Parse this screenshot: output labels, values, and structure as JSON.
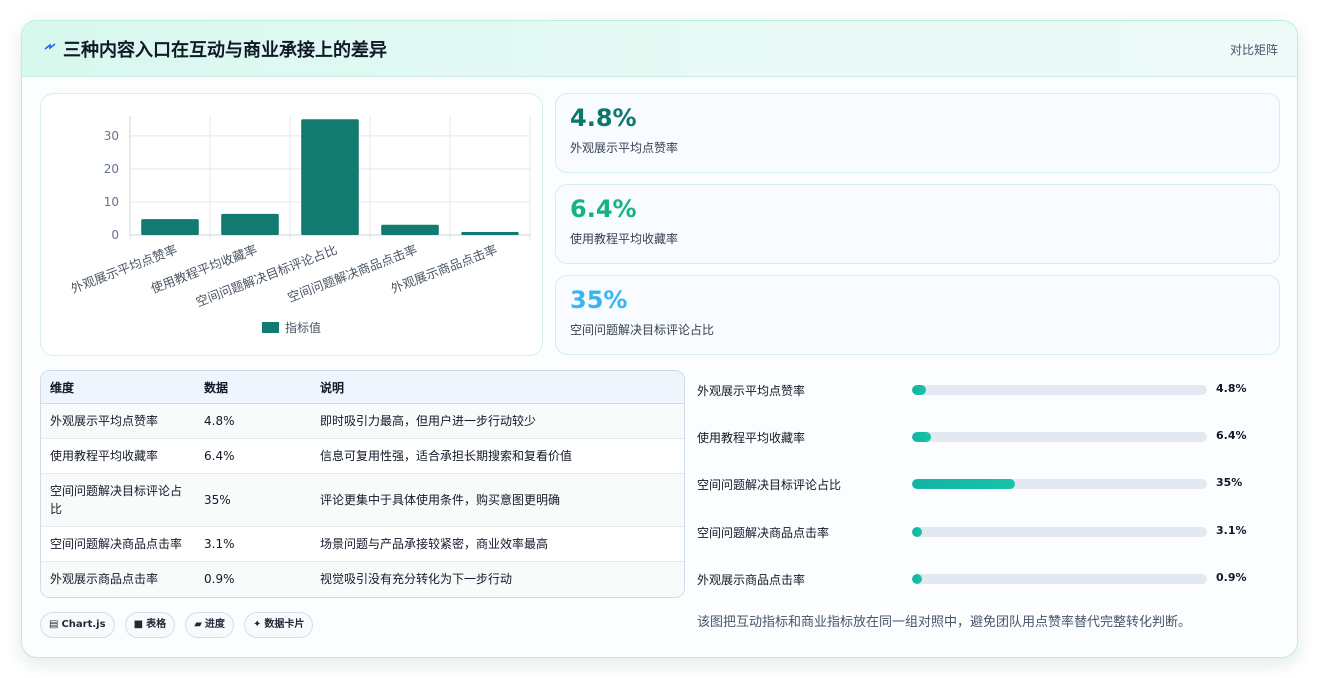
{
  "header": {
    "title": "三种内容入口在互动与商业承接上的差异",
    "tag": "对比矩阵"
  },
  "colors": {
    "bar": "#127a6e",
    "kpi_1": "#0f766e",
    "kpi_2": "#16b37f",
    "kpi_3": "#3bb5f0",
    "progress": "#12b3a4"
  },
  "chart_data": {
    "type": "bar",
    "categories": [
      "外观展示平均点赞率",
      "使用教程平均收藏率",
      "空间问题解决目标评论占比",
      "空间问题解决商品点击率",
      "外观展示商品点击率"
    ],
    "series": [
      {
        "name": "指标值",
        "values": [
          4.8,
          6.4,
          35,
          3.1,
          0.9
        ]
      }
    ],
    "yticks": [
      "0",
      "10",
      "20",
      "30"
    ],
    "ylim": [
      0,
      36
    ],
    "grid": true,
    "legend": "bottom"
  },
  "kpis": [
    {
      "value": "4.8%",
      "label": "外观展示平均点赞率"
    },
    {
      "value": "6.4%",
      "label": "使用教程平均收藏率"
    },
    {
      "value": "35%",
      "label": "空间问题解决目标评论占比"
    }
  ],
  "table": {
    "headers": [
      "维度",
      "数据",
      "说明"
    ],
    "rows": [
      [
        "外观展示平均点赞率",
        "4.8%",
        "即时吸引力最高，但用户进一步行动较少"
      ],
      [
        "使用教程平均收藏率",
        "6.4%",
        "信息可复用性强，适合承担长期搜索和复看价值"
      ],
      [
        "空间问题解决目标评论占比",
        "35%",
        "评论更集中于具体使用条件，购买意图更明确"
      ],
      [
        "空间问题解决商品点击率",
        "3.1%",
        "场景问题与产品承接较紧密，商业效率最高"
      ],
      [
        "外观展示商品点击率",
        "0.9%",
        "视觉吸引没有充分转化为下一步行动"
      ]
    ]
  },
  "chips": [
    {
      "icon": "chart-icon",
      "glyph": "▤",
      "label": "Chart.js"
    },
    {
      "icon": "table-icon",
      "glyph": "■",
      "label": "表格"
    },
    {
      "icon": "progress-icon",
      "glyph": "▰",
      "label": "进度"
    },
    {
      "icon": "sparkle-icon",
      "glyph": "✦",
      "label": "数据卡片"
    }
  ],
  "progress": [
    {
      "label": "外观展示平均点赞率",
      "value": "4.8%",
      "fraction": 0.048
    },
    {
      "label": "使用教程平均收藏率",
      "value": "6.4%",
      "fraction": 0.064
    },
    {
      "label": "空间问题解决目标评论占比",
      "value": "35%",
      "fraction": 0.35
    },
    {
      "label": "空间问题解决商品点击率",
      "value": "3.1%",
      "fraction": 0.031
    },
    {
      "label": "外观展示商品点击率",
      "value": "0.9%",
      "fraction": 0.009
    }
  ],
  "note": "该图把互动指标和商业指标放在同一组对照中，避免团队用点赞率替代完整转化判断。"
}
